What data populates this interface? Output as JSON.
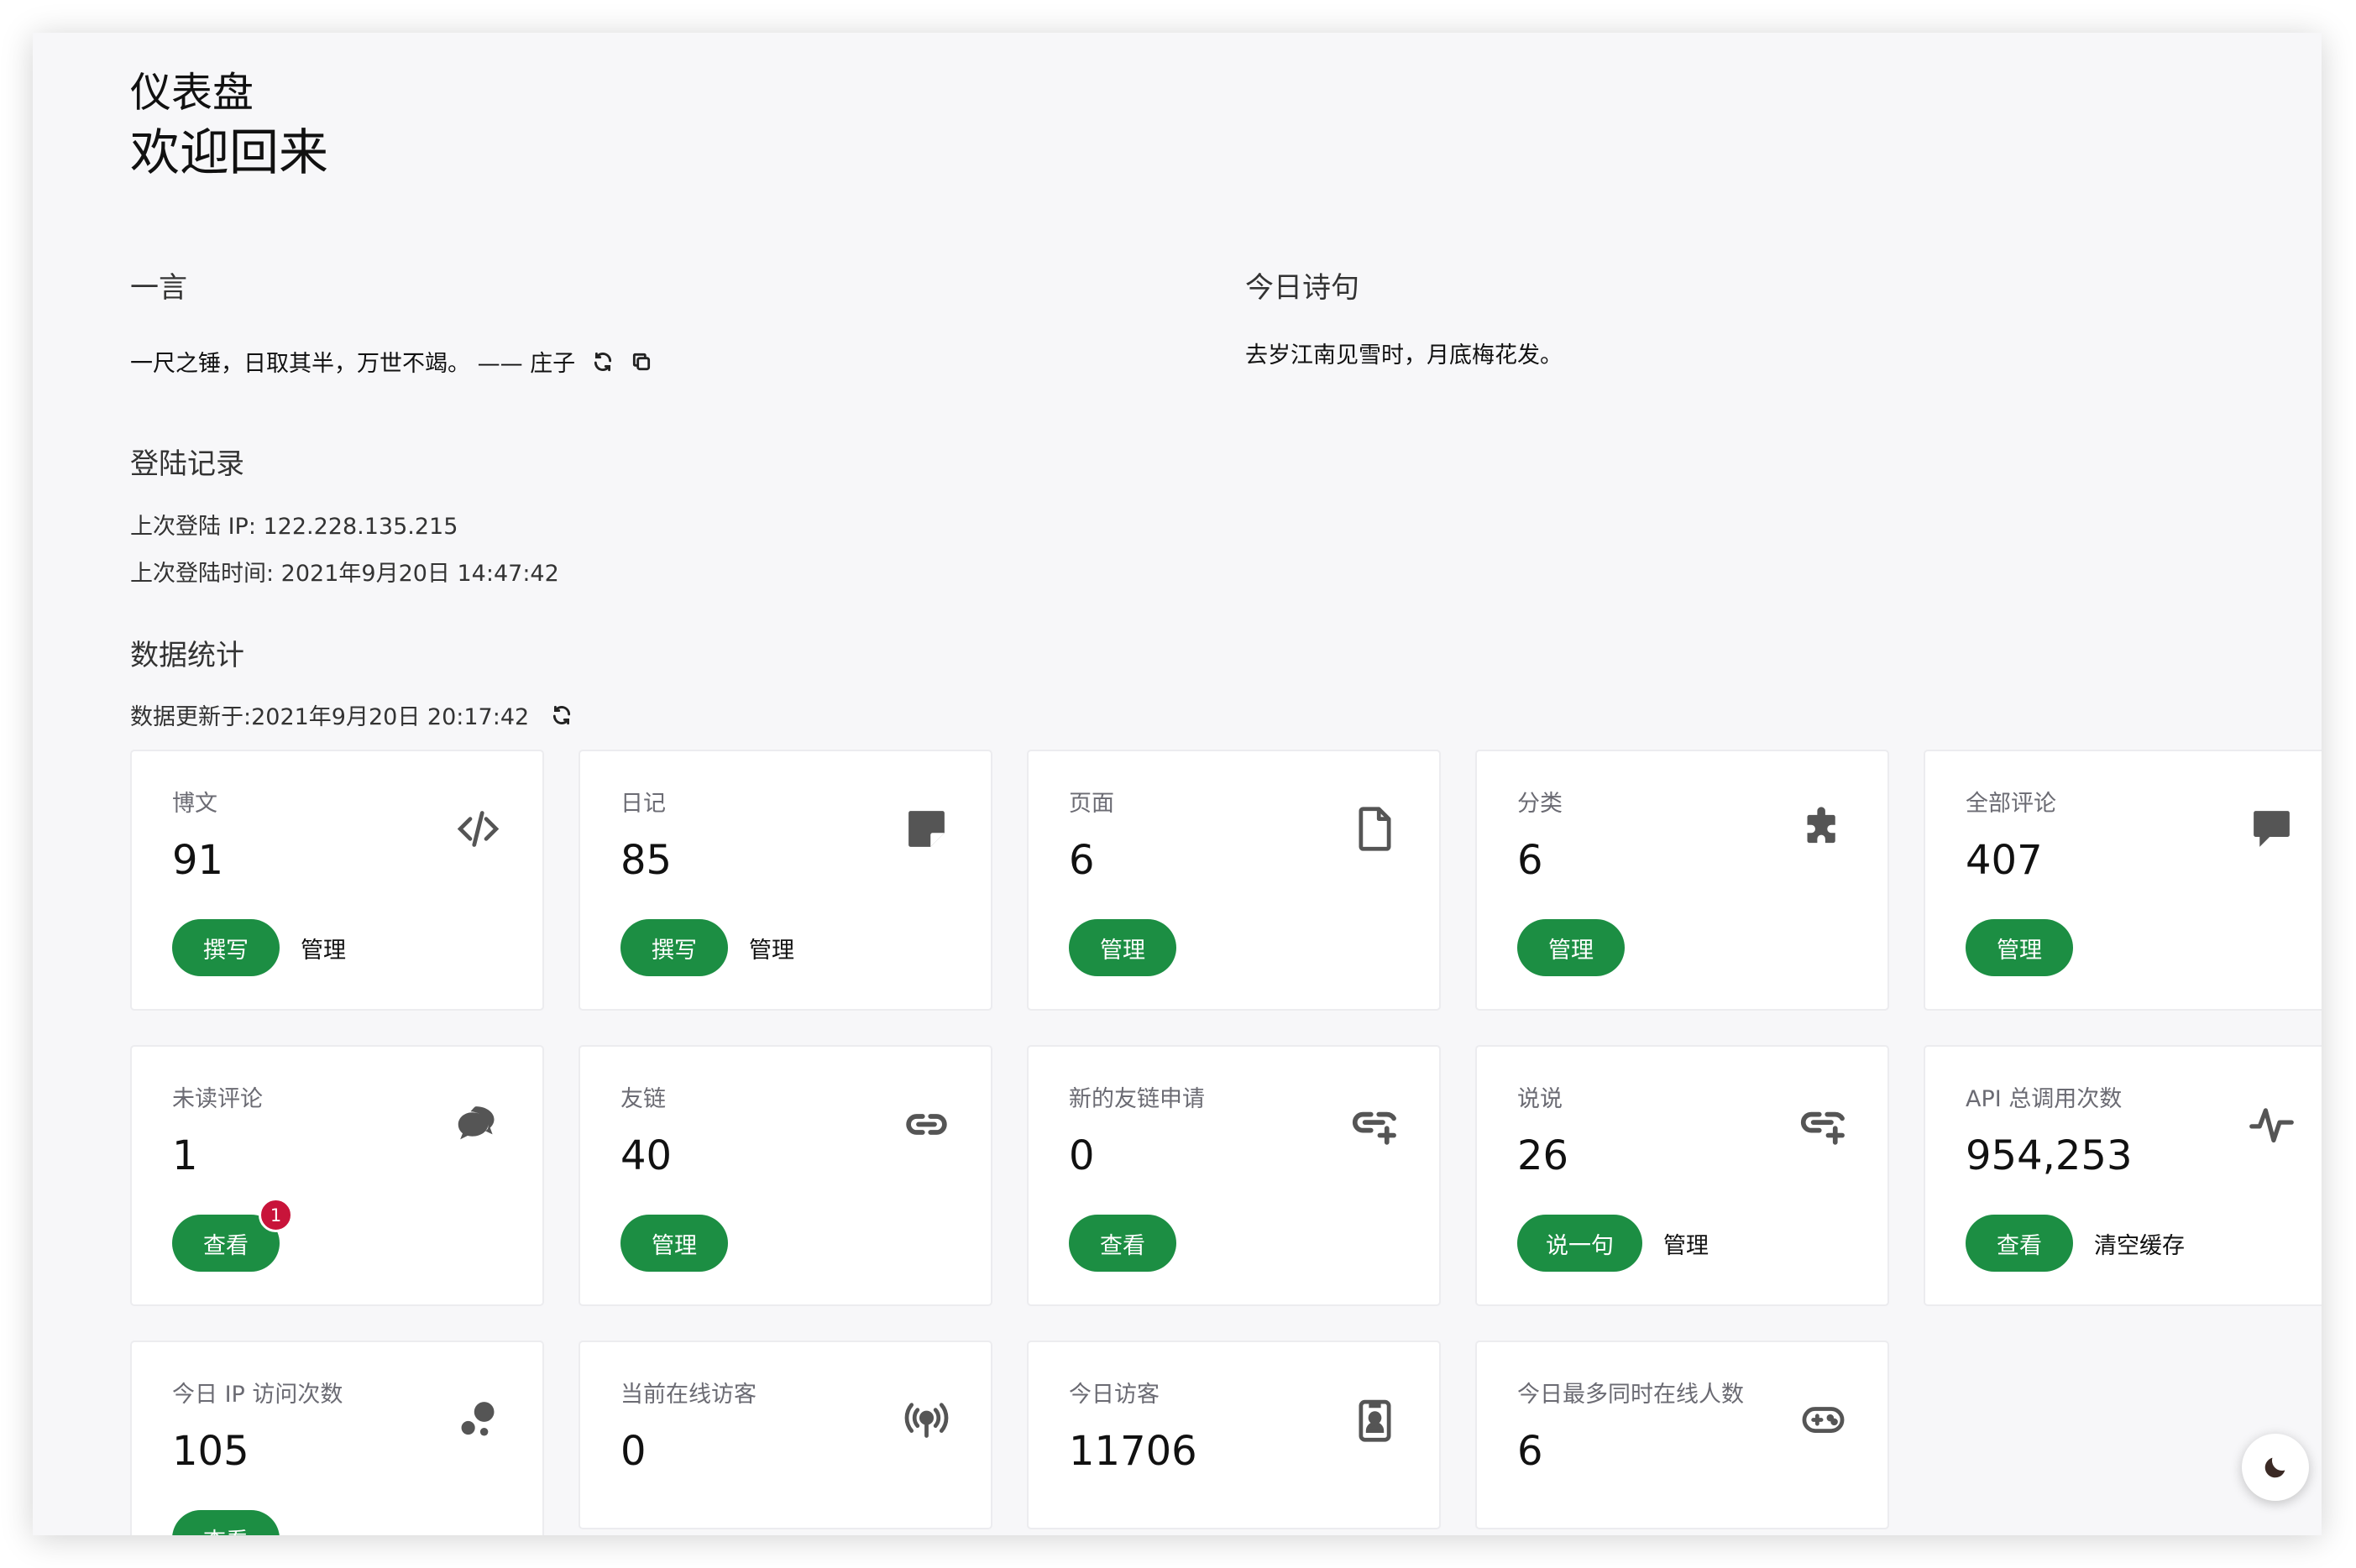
{
  "header": {
    "title": "仪表盘",
    "welcome": "欢迎回来"
  },
  "hitokoto": {
    "heading": "一言",
    "text": "一尺之锤，日取其半，万世不竭。 —— 庄子",
    "refresh_icon": "refresh-icon",
    "copy_icon": "copy-icon"
  },
  "poem": {
    "heading": "今日诗句",
    "text": "去岁江南见雪时，月底梅花发。"
  },
  "login": {
    "heading": "登陆记录",
    "ip": "上次登陆 IP: 122.228.135.215",
    "time": "上次登陆时间: 2021年9月20日 14:47:42"
  },
  "stats": {
    "heading": "数据统计",
    "updated": "数据更新于:2021年9月20日 20:17:42",
    "cards": [
      {
        "label": "博文",
        "value": "91",
        "icon": "code-icon",
        "btn": "撰写",
        "link": "管理"
      },
      {
        "label": "日记",
        "value": "85",
        "icon": "sticky-note-icon",
        "btn": "撰写",
        "link": "管理"
      },
      {
        "label": "页面",
        "value": "6",
        "icon": "file-icon",
        "btn": "管理",
        "link": ""
      },
      {
        "label": "分类",
        "value": "6",
        "icon": "puzzle-icon",
        "btn": "管理",
        "link": ""
      },
      {
        "label": "全部评论",
        "value": "407",
        "icon": "comment-icon",
        "btn": "管理",
        "link": ""
      },
      {
        "label": "未读评论",
        "value": "1",
        "icon": "comments-icon",
        "btn": "查看",
        "link": "",
        "badge": "1"
      },
      {
        "label": "友链",
        "value": "40",
        "icon": "link-icon",
        "btn": "管理",
        "link": ""
      },
      {
        "label": "新的友链申请",
        "value": "0",
        "icon": "link-add-icon",
        "btn": "查看",
        "link": ""
      },
      {
        "label": "说说",
        "value": "26",
        "icon": "link-add-icon",
        "btn": "说一句",
        "link": "管理"
      },
      {
        "label": "API 总调用次数",
        "value": "954,253",
        "icon": "activity-icon",
        "btn": "查看",
        "link": "清空缓存"
      },
      {
        "label": "今日 IP 访问次数",
        "value": "105",
        "icon": "bubbles-icon",
        "btn": "查看",
        "link": ""
      },
      {
        "label": "当前在线访客",
        "value": "0",
        "icon": "broadcast-icon",
        "btn": "",
        "link": ""
      },
      {
        "label": "今日访客",
        "value": "11706",
        "icon": "id-badge-icon",
        "btn": "",
        "link": ""
      },
      {
        "label": "今日最多同时在线人数",
        "value": "6",
        "icon": "gamepad-icon",
        "btn": "",
        "link": ""
      }
    ]
  },
  "theme_toggle_icon": "moon-icon"
}
